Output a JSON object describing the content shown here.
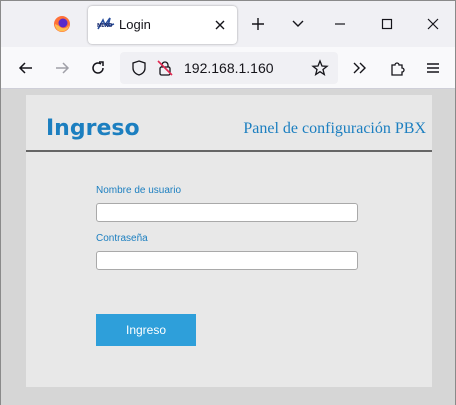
{
  "browser": {
    "tab": {
      "title": "Login",
      "favicon_text": "NEXO"
    },
    "address": {
      "url": "192.168.1.160"
    },
    "icons": {
      "firefox": "firefox-logo-icon",
      "close_tab": "close-icon",
      "new_tab": "plus-icon",
      "list_all_tabs": "chevron-down-icon",
      "back": "arrow-left-icon",
      "forward": "arrow-right-icon",
      "reload": "reload-icon",
      "shield": "shield-icon",
      "insecure": "insecure-lock-icon",
      "bookmark": "star-icon",
      "overflow": "double-chevron-icon",
      "extensions": "puzzle-icon",
      "menu": "hamburger-icon"
    },
    "window_controls": {
      "minimize": "minimize-icon",
      "maximize": "maximize-icon",
      "close": "close-icon"
    }
  },
  "page": {
    "header": {
      "title": "Ingreso",
      "subtitle": "Panel de configuración PBX"
    },
    "form": {
      "username_label": "Nombre de usuario",
      "username_value": "",
      "password_label": "Contraseña",
      "password_value": "",
      "submit_label": "Ingreso"
    },
    "colors": {
      "accent": "#1c7fc0",
      "button": "#2e9fda",
      "panel": "#e8e8e8",
      "backdrop": "#d6d6d6"
    }
  }
}
